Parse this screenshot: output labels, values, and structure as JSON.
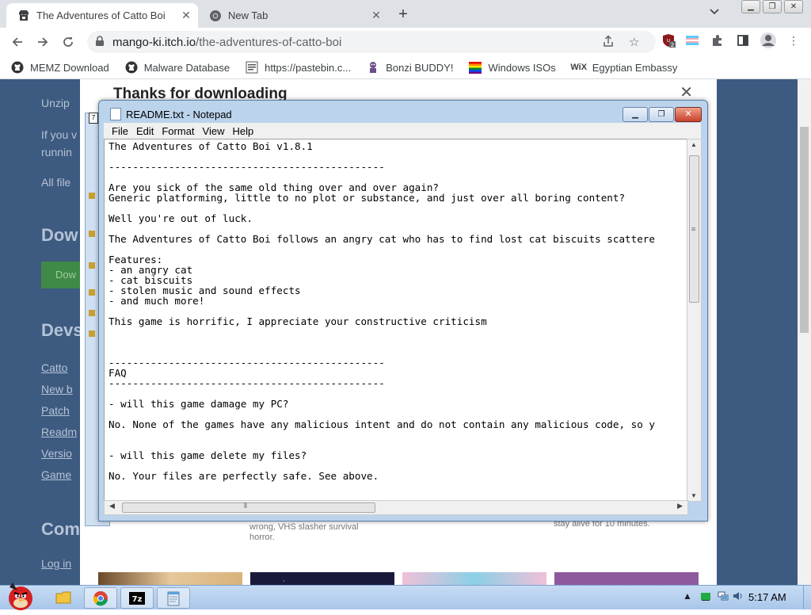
{
  "browser": {
    "tabs": [
      {
        "title": "The Adventures of Catto Boi b",
        "active": true
      },
      {
        "title": "New Tab",
        "active": false
      }
    ],
    "new_tab_symbol": "+",
    "url_domain": "mango-ki.itch.io",
    "url_path": "/the-adventures-of-catto-boi",
    "extension_badge": "2",
    "bookmarks": [
      {
        "label": "MEMZ Download",
        "icon": "github-icon"
      },
      {
        "label": "Malware Database",
        "icon": "github-icon"
      },
      {
        "label": "https://pastebin.c...",
        "icon": "pastebin-icon"
      },
      {
        "label": "Bonzi BUDDY!",
        "icon": "bonzi-icon"
      },
      {
        "label": "Windows ISOs",
        "icon": "windows-flag-icon"
      },
      {
        "label": "Egyptian Embassy",
        "icon": "wix-icon",
        "icon_text": "WiX"
      }
    ]
  },
  "page": {
    "modal_title": "Thanks for downloading",
    "left_snippets": [
      "Unzip",
      "If you v",
      "runnin",
      "All file",
      "Dow",
      "Dow",
      "Devs",
      "Catto",
      "New b",
      "Patch",
      "Readm",
      "Versio",
      "Game",
      "Com",
      "Log in"
    ],
    "card_texts": [
      "wrong, VHS slasher survival",
      "horror.",
      "stay alive for 10 minutes."
    ]
  },
  "notepad": {
    "title": "README.txt - Notepad",
    "menu": [
      "File",
      "Edit",
      "Format",
      "View",
      "Help"
    ],
    "content": "The Adventures of Catto Boi v1.8.1\n\n----------------------------------------------\n\nAre you sick of the same old thing over and over again?\nGeneric platforming, little to no plot or substance, and just over all boring content?\n\nWell you're out of luck.\n\nThe Adventures of Catto Boi follows an angry cat who has to find lost cat biscuits scattere\n\nFeatures:\n- an angry cat\n- cat biscuits\n- stolen music and sound effects\n- and much more!\n\nThis game is horrific, I appreciate your constructive criticism\n\n\n\n----------------------------------------------\nFAQ\n----------------------------------------------\n\n- will this game damage my PC?\n\nNo. None of the games have any malicious intent and do not contain any malicious code, so y\n\n\n- will this game delete my files?\n\nNo. Your files are perfectly safe. See above."
  },
  "taskbar": {
    "clock": "5:17 AM"
  }
}
